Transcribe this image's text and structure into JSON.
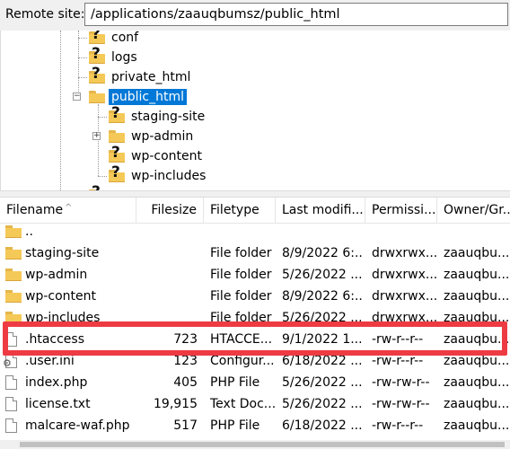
{
  "remote_site": {
    "label": "Remote site:",
    "path": "/applications/zaauqbumsz/public_html"
  },
  "tree": {
    "items": [
      {
        "label": "conf",
        "icon": "unknown-folder-icon",
        "selected": false
      },
      {
        "label": "logs",
        "icon": "unknown-folder-icon",
        "selected": false
      },
      {
        "label": "private_html",
        "icon": "unknown-folder-icon",
        "selected": false
      },
      {
        "label": "public_html",
        "icon": "folder-icon",
        "selected": true,
        "expanded": true
      },
      {
        "label": "staging-site",
        "icon": "unknown-folder-icon",
        "selected": false
      },
      {
        "label": "wp-admin",
        "icon": "folder-icon",
        "selected": false,
        "expandable": true
      },
      {
        "label": "wp-content",
        "icon": "unknown-folder-icon",
        "selected": false
      },
      {
        "label": "wp-includes",
        "icon": "unknown-folder-icon",
        "selected": false
      }
    ]
  },
  "list": {
    "headers": [
      "Filename",
      "Filesize",
      "Filetype",
      "Last modifi...",
      "Permissi...",
      "Owner/Gr..."
    ],
    "rows": [
      {
        "name": "..",
        "size": "",
        "type": "",
        "modified": "",
        "perms": "",
        "owner": "",
        "icon": "folder-icon"
      },
      {
        "name": "staging-site",
        "size": "",
        "type": "File folder",
        "modified": "8/9/2022 6:...",
        "perms": "drwxrwx...",
        "owner": "zaauqbu...",
        "icon": "folder-icon"
      },
      {
        "name": "wp-admin",
        "size": "",
        "type": "File folder",
        "modified": "5/26/2022 ...",
        "perms": "drwxrwx...",
        "owner": "zaauqbu...",
        "icon": "folder-icon"
      },
      {
        "name": "wp-content",
        "size": "",
        "type": "File folder",
        "modified": "8/9/2022 6:...",
        "perms": "drwxrwx...",
        "owner": "zaauqbu...",
        "icon": "folder-icon"
      },
      {
        "name": "wp-includes",
        "size": "",
        "type": "File folder",
        "modified": "5/26/2022 ...",
        "perms": "drwxrwx...",
        "owner": "zaauqbu...",
        "icon": "folder-icon"
      },
      {
        "name": ".htaccess",
        "size": "723",
        "type": "HTACCE...",
        "modified": "9/1/2022 1...",
        "perms": "-rw-r--r--",
        "owner": "zaauqbu...",
        "icon": "file-icon"
      },
      {
        "name": ".user.ini",
        "size": "123",
        "type": "Configur...",
        "modified": "6/18/2022 ...",
        "perms": "-rw-r--r--",
        "owner": "zaauqbu...",
        "icon": "settings-file-icon"
      },
      {
        "name": "index.php",
        "size": "405",
        "type": "PHP File",
        "modified": "5/26/2022 ...",
        "perms": "-rw-rw-r--",
        "owner": "zaauqbu...",
        "icon": "file-icon"
      },
      {
        "name": "license.txt",
        "size": "19,915",
        "type": "Text Doc...",
        "modified": "5/26/2022 ...",
        "perms": "-rw-rw-r--",
        "owner": "zaauqbu...",
        "icon": "file-icon"
      },
      {
        "name": "malcare-waf.php",
        "size": "517",
        "type": "PHP File",
        "modified": "6/18/2022 ...",
        "perms": "-rw-r--r--",
        "owner": "zaauqbu...",
        "icon": "file-icon"
      }
    ]
  },
  "colors": {
    "selection": "#0078d7",
    "highlight_box": "#ee3b43",
    "folder": "#f5c957"
  }
}
